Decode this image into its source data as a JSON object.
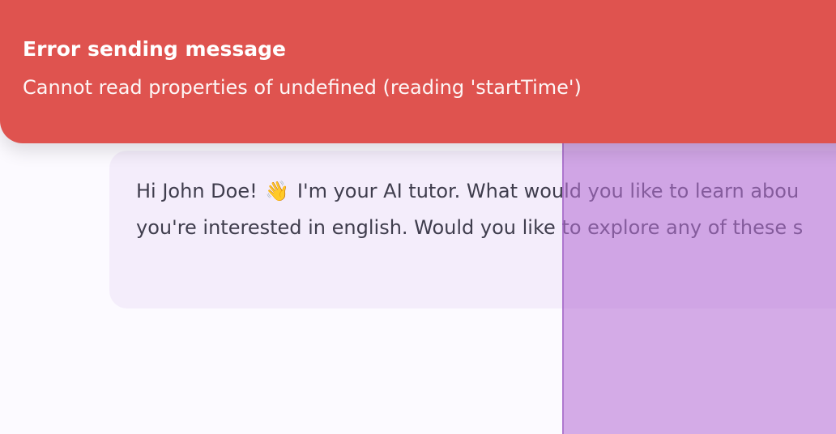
{
  "toast": {
    "title": "Error sending message",
    "message": "Cannot read properties of undefined (reading 'startTime')",
    "background_color": "#df534f"
  },
  "chat": {
    "message": {
      "line1_prefix": "Hi John Doe!",
      "emoji": "👋",
      "line1_suffix": "I'm your AI tutor. What would you like to learn abou",
      "line2": "you're interested in english. Would you like to explore any of these s",
      "bubble_color": "#f4edfb",
      "text_color": "#3f3d4d"
    }
  },
  "overlay": {
    "color": "#b671d6"
  }
}
